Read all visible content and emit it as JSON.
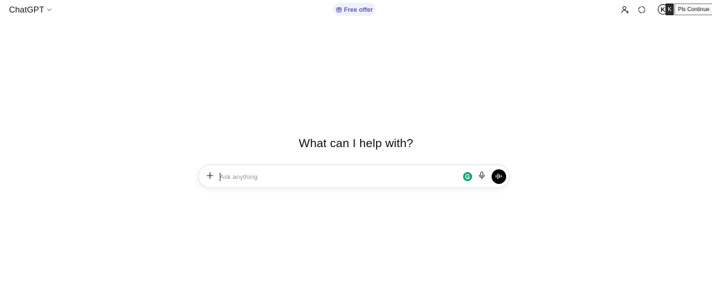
{
  "header": {
    "model_name": "ChatGPT",
    "model_dropdown_icon": "chevron-down-icon",
    "free_offer_label": "Free offer",
    "free_offer_icon": "gift-icon",
    "share_icon": "add-person-icon",
    "temporary_chat_icon": "dashed-circle-icon",
    "avatar_initial": "K",
    "extension_badge": "K",
    "tooltip_text": "Pls Continue"
  },
  "main": {
    "heading": "What can I help with?"
  },
  "composer": {
    "placeholder": "Ask anything",
    "value": "",
    "attach_icon": "plus-icon",
    "grammar_icon": "grammarly-icon",
    "mic_icon": "microphone-icon",
    "voice_icon": "voice-waveform-icon"
  },
  "colors": {
    "offer_bg": "#f1f0fd",
    "offer_text": "#5e55c7",
    "grammarly_green": "#15a37d",
    "voice_button": "#000000"
  }
}
